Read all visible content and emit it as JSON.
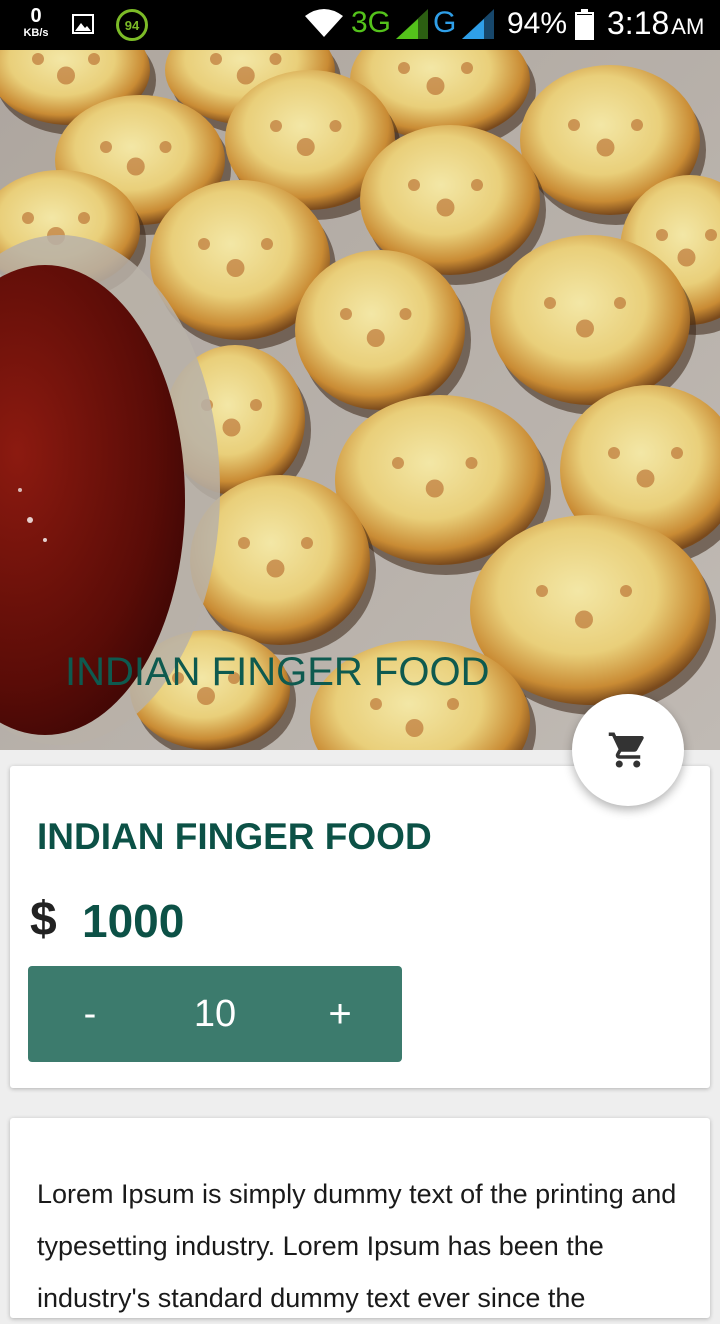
{
  "status_bar": {
    "net_speed_value": "0",
    "net_speed_unit": "KB/s",
    "badge_value": "94",
    "network_3g": "3G",
    "network_g": "G",
    "battery_percent": "94%",
    "battery_level": 0.94,
    "time": "3:18",
    "time_ampm": "AM"
  },
  "hero": {
    "image_icon": "food-photo",
    "overlay_title": "INDIAN FINGER FOOD"
  },
  "fab": {
    "icon": "cart-icon"
  },
  "product": {
    "name": "INDIAN FINGER FOOD",
    "currency_symbol": "$",
    "price": "1000",
    "quantity": {
      "minus_label": "-",
      "value": "10",
      "plus_label": "+"
    }
  },
  "description": {
    "text": "Lorem Ipsum is simply dummy text of the printing and typesetting industry. Lorem Ipsum has been the industry's standard dummy text ever since the"
  },
  "colors": {
    "accent": "#0c5146",
    "stepper": "#3c7b6d",
    "status_bar": "#000000"
  }
}
